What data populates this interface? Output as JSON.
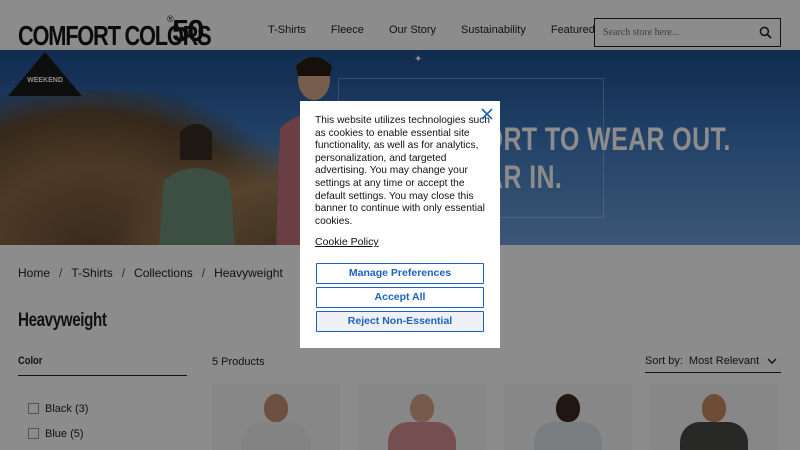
{
  "header": {
    "logo_word": "COMFORT COLORS",
    "logo_reg": "®",
    "logo_number": "50",
    "nav": [
      "T-Shirts",
      "Fleece",
      "Our Story",
      "Sustainability",
      "Featured"
    ],
    "search_placeholder": "Search store here...",
    "search_icon": "search-icon"
  },
  "hero": {
    "line1": "FORT TO WEAR OUT.",
    "line2": "EAR IN.",
    "badge_text": "WEEKEND"
  },
  "breadcrumb": [
    "Home",
    "T-Shirts",
    "Collections",
    "Heavyweight"
  ],
  "page_title": "Heavyweight",
  "filters": {
    "heading": "Color",
    "items": [
      {
        "label": "Black (3)"
      },
      {
        "label": "Blue (5)"
      }
    ]
  },
  "results": {
    "count": "5 Products",
    "sort_label": "Sort by:",
    "sort_value": "Most Relevant"
  },
  "cookie_modal": {
    "text": "This website utilizes technologies such as cookies to enable essential site functionality, as well as for analytics, personalization, and targeted advertising. You may change your settings at any time or accept the default settings. You may close this banner to continue with only essential cookies.",
    "policy_link": "Cookie Policy",
    "buttons": {
      "manage": "Manage Preferences",
      "accept": "Accept All",
      "reject": "Reject Non-Essential"
    },
    "accent_color": "#1c63c0"
  }
}
